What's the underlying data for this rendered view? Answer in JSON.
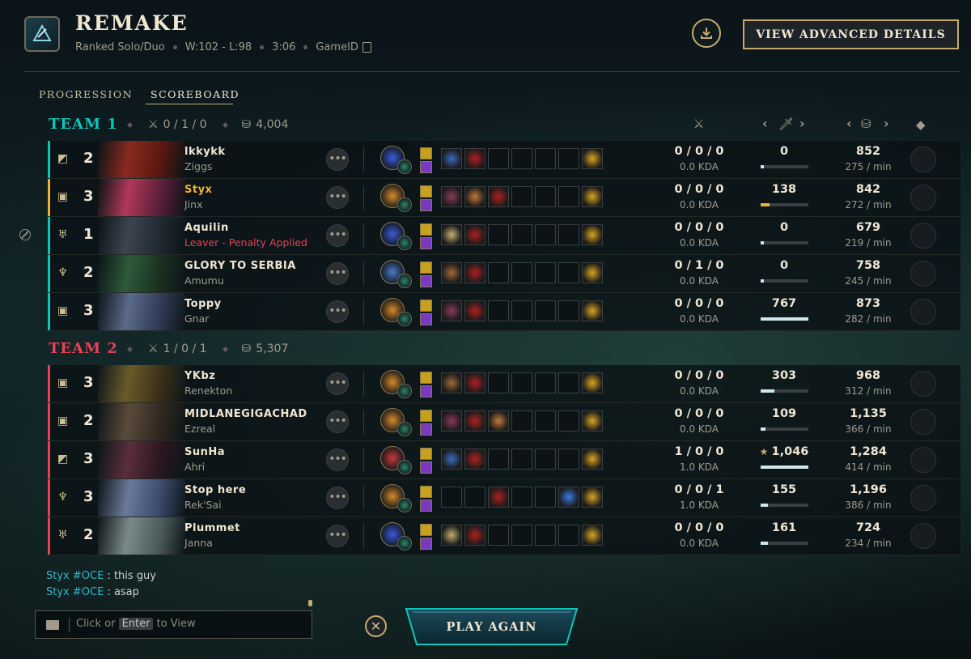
{
  "header": {
    "title": "REMAKE",
    "queue": "Ranked Solo/Duo",
    "record": "W:102 - L:98",
    "duration": "3:06",
    "game_id_label": "GameID",
    "advanced_button": "VIEW ADVANCED DETAILS"
  },
  "tabs": [
    "PROGRESSION",
    "SCOREBOARD"
  ],
  "active_tab": "SCOREBOARD",
  "teams": [
    {
      "name": "TEAM 1",
      "color": "#0ac8b9",
      "kda": "0 / 1 / 0",
      "gold": "4,004",
      "players": [
        {
          "position": "mid",
          "level": "2",
          "name": "lkkykk",
          "champion": "Ziggs",
          "kda": "0 / 0 / 0",
          "kda_ratio": "0.0 KDA",
          "damage": "0",
          "damage_fraction": 0.07,
          "gold": "852",
          "gold_per_min": "275 / min",
          "highlight": false
        },
        {
          "position": "bottom",
          "level": "3",
          "name": "Styx",
          "champion": "Jinx",
          "kda": "0 / 0 / 0",
          "kda_ratio": "0.0 KDA",
          "damage": "138",
          "damage_fraction": 0.18,
          "gold": "842",
          "gold_per_min": "272 / min",
          "highlight": true
        },
        {
          "position": "support",
          "level": "1",
          "name": "Aquilin",
          "champion": "Leaver - Penalty Applied",
          "kda": "0 / 0 / 0",
          "kda_ratio": "0.0 KDA",
          "damage": "0",
          "damage_fraction": 0.07,
          "gold": "679",
          "gold_per_min": "219 / min",
          "highlight": false,
          "leaver": true
        },
        {
          "position": "jungle",
          "level": "2",
          "name": "GLORY TO SERBIA",
          "champion": "Amumu",
          "kda": "0 / 1 / 0",
          "kda_ratio": "0.0 KDA",
          "damage": "0",
          "damage_fraction": 0.07,
          "gold": "758",
          "gold_per_min": "245 / min",
          "highlight": false
        },
        {
          "position": "top",
          "level": "3",
          "name": "Toppy",
          "champion": "Gnar",
          "kda": "0 / 0 / 0",
          "kda_ratio": "0.0 KDA",
          "damage": "767",
          "damage_fraction": 1.0,
          "gold": "873",
          "gold_per_min": "282 / min",
          "highlight": false
        }
      ]
    },
    {
      "name": "TEAM 2",
      "color": "#e84057",
      "kda": "1 / 0 / 1",
      "gold": "5,307",
      "players": [
        {
          "position": "top",
          "level": "3",
          "name": "YKbz",
          "champion": "Renekton",
          "kda": "0 / 0 / 0",
          "kda_ratio": "0.0 KDA",
          "damage": "303",
          "damage_fraction": 0.29,
          "gold": "968",
          "gold_per_min": "312 / min",
          "highlight": false
        },
        {
          "position": "bottom",
          "level": "2",
          "name": "MIDLANEGIGACHAD",
          "champion": "Ezreal",
          "kda": "0 / 0 / 0",
          "kda_ratio": "0.0 KDA",
          "damage": "109",
          "damage_fraction": 0.11,
          "gold": "1,135",
          "gold_per_min": "366 / min",
          "highlight": false
        },
        {
          "position": "mid",
          "level": "3",
          "name": "SunHa",
          "champion": "Ahri",
          "kda": "1 / 0 / 0",
          "kda_ratio": "1.0 KDA",
          "damage": "1,046",
          "damage_fraction": 1.0,
          "gold": "1,284",
          "gold_per_min": "414 / min",
          "highlight": false,
          "star": true
        },
        {
          "position": "jungle",
          "level": "3",
          "name": "Stop here",
          "champion": "Rek'Sai",
          "kda": "0 / 0 / 1",
          "kda_ratio": "1.0 KDA",
          "damage": "155",
          "damage_fraction": 0.15,
          "gold": "1,196",
          "gold_per_min": "386 / min",
          "highlight": false
        },
        {
          "position": "support",
          "level": "2",
          "name": "Plummet",
          "champion": "Janna",
          "kda": "0 / 0 / 0",
          "kda_ratio": "0.0 KDA",
          "damage": "161",
          "damage_fraction": 0.16,
          "gold": "724",
          "gold_per_min": "234 / min",
          "highlight": false
        }
      ]
    }
  ],
  "chat": [
    {
      "who": "Styx #OCE",
      "text": " : this guy"
    },
    {
      "who": "Styx #OCE",
      "text": " : asap"
    }
  ],
  "chat_input": {
    "prefix": "Click or",
    "key": "Enter",
    "suffix": "to View"
  },
  "play_again": "PLAY AGAIN",
  "colors": {
    "gold": "#c8aa6e",
    "text": "#f0e6d2",
    "team1": "#0ac8b9",
    "team2": "#e84057",
    "highlight": "#f0b232"
  }
}
